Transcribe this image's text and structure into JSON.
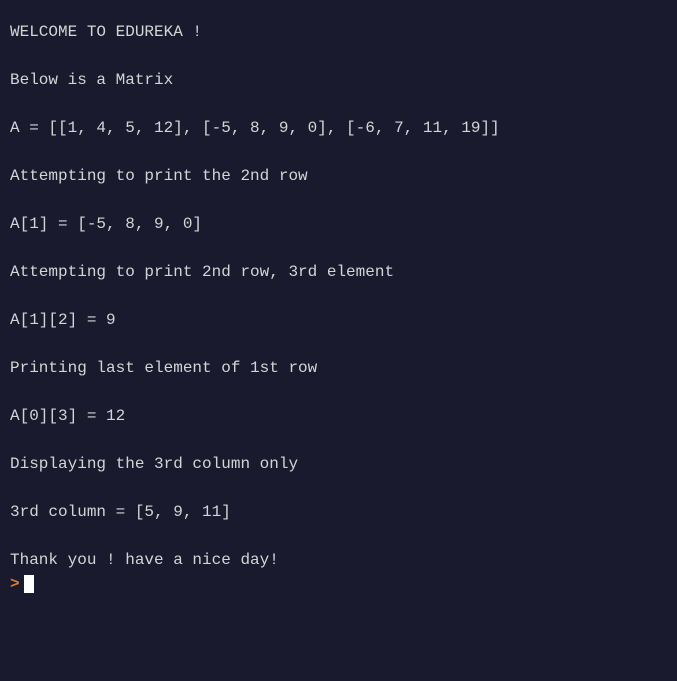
{
  "lines": {
    "welcome": "WELCOME TO EDUREKA !",
    "below": "Below is a Matrix",
    "matrix_def": "A = [[1, 4, 5, 12], [-5, 8, 9, 0], [-6, 7, 11, 19]]",
    "attempt_row2": "Attempting to print the 2nd row",
    "row2_out": "A[1] = [-5, 8, 9, 0]",
    "attempt_row2_elem3": "Attempting to print 2nd row, 3rd element",
    "row2_elem3_out": "A[1][2] = 9",
    "print_last_elem": "Printing last element of 1st row",
    "last_elem_out": "A[0][3] = 12",
    "display_col3": "Displaying the 3rd column only",
    "col3_out": "3rd column = [5, 9, 11]",
    "thanks": "Thank you ! have a nice day!"
  },
  "prompt": {
    "symbol": ">"
  }
}
